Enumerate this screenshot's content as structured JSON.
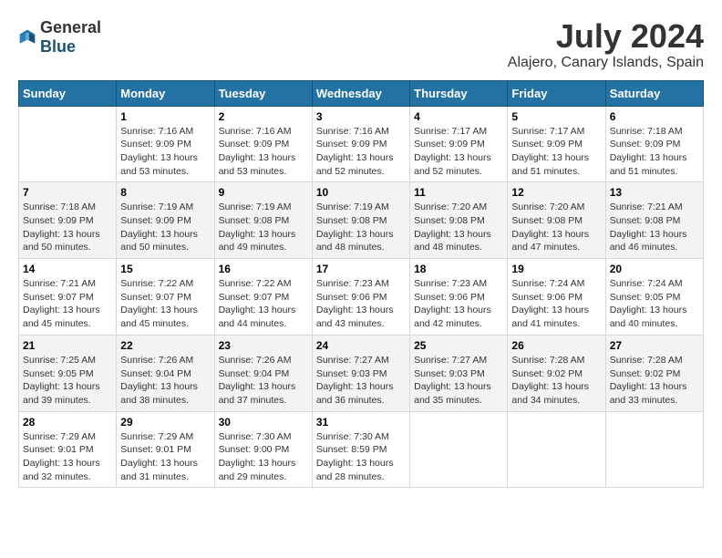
{
  "header": {
    "logo_general": "General",
    "logo_blue": "Blue",
    "month_year": "July 2024",
    "location": "Alajero, Canary Islands, Spain"
  },
  "days_of_week": [
    "Sunday",
    "Monday",
    "Tuesday",
    "Wednesday",
    "Thursday",
    "Friday",
    "Saturday"
  ],
  "weeks": [
    [
      {
        "day": "",
        "info": ""
      },
      {
        "day": "1",
        "info": "Sunrise: 7:16 AM\nSunset: 9:09 PM\nDaylight: 13 hours and 53 minutes."
      },
      {
        "day": "2",
        "info": "Sunrise: 7:16 AM\nSunset: 9:09 PM\nDaylight: 13 hours and 53 minutes."
      },
      {
        "day": "3",
        "info": "Sunrise: 7:16 AM\nSunset: 9:09 PM\nDaylight: 13 hours and 52 minutes."
      },
      {
        "day": "4",
        "info": "Sunrise: 7:17 AM\nSunset: 9:09 PM\nDaylight: 13 hours and 52 minutes."
      },
      {
        "day": "5",
        "info": "Sunrise: 7:17 AM\nSunset: 9:09 PM\nDaylight: 13 hours and 51 minutes."
      },
      {
        "day": "6",
        "info": "Sunrise: 7:18 AM\nSunset: 9:09 PM\nDaylight: 13 hours and 51 minutes."
      }
    ],
    [
      {
        "day": "7",
        "info": "Sunrise: 7:18 AM\nSunset: 9:09 PM\nDaylight: 13 hours and 50 minutes."
      },
      {
        "day": "8",
        "info": "Sunrise: 7:19 AM\nSunset: 9:09 PM\nDaylight: 13 hours and 50 minutes."
      },
      {
        "day": "9",
        "info": "Sunrise: 7:19 AM\nSunset: 9:08 PM\nDaylight: 13 hours and 49 minutes."
      },
      {
        "day": "10",
        "info": "Sunrise: 7:19 AM\nSunset: 9:08 PM\nDaylight: 13 hours and 48 minutes."
      },
      {
        "day": "11",
        "info": "Sunrise: 7:20 AM\nSunset: 9:08 PM\nDaylight: 13 hours and 48 minutes."
      },
      {
        "day": "12",
        "info": "Sunrise: 7:20 AM\nSunset: 9:08 PM\nDaylight: 13 hours and 47 minutes."
      },
      {
        "day": "13",
        "info": "Sunrise: 7:21 AM\nSunset: 9:08 PM\nDaylight: 13 hours and 46 minutes."
      }
    ],
    [
      {
        "day": "14",
        "info": "Sunrise: 7:21 AM\nSunset: 9:07 PM\nDaylight: 13 hours and 45 minutes."
      },
      {
        "day": "15",
        "info": "Sunrise: 7:22 AM\nSunset: 9:07 PM\nDaylight: 13 hours and 45 minutes."
      },
      {
        "day": "16",
        "info": "Sunrise: 7:22 AM\nSunset: 9:07 PM\nDaylight: 13 hours and 44 minutes."
      },
      {
        "day": "17",
        "info": "Sunrise: 7:23 AM\nSunset: 9:06 PM\nDaylight: 13 hours and 43 minutes."
      },
      {
        "day": "18",
        "info": "Sunrise: 7:23 AM\nSunset: 9:06 PM\nDaylight: 13 hours and 42 minutes."
      },
      {
        "day": "19",
        "info": "Sunrise: 7:24 AM\nSunset: 9:06 PM\nDaylight: 13 hours and 41 minutes."
      },
      {
        "day": "20",
        "info": "Sunrise: 7:24 AM\nSunset: 9:05 PM\nDaylight: 13 hours and 40 minutes."
      }
    ],
    [
      {
        "day": "21",
        "info": "Sunrise: 7:25 AM\nSunset: 9:05 PM\nDaylight: 13 hours and 39 minutes."
      },
      {
        "day": "22",
        "info": "Sunrise: 7:26 AM\nSunset: 9:04 PM\nDaylight: 13 hours and 38 minutes."
      },
      {
        "day": "23",
        "info": "Sunrise: 7:26 AM\nSunset: 9:04 PM\nDaylight: 13 hours and 37 minutes."
      },
      {
        "day": "24",
        "info": "Sunrise: 7:27 AM\nSunset: 9:03 PM\nDaylight: 13 hours and 36 minutes."
      },
      {
        "day": "25",
        "info": "Sunrise: 7:27 AM\nSunset: 9:03 PM\nDaylight: 13 hours and 35 minutes."
      },
      {
        "day": "26",
        "info": "Sunrise: 7:28 AM\nSunset: 9:02 PM\nDaylight: 13 hours and 34 minutes."
      },
      {
        "day": "27",
        "info": "Sunrise: 7:28 AM\nSunset: 9:02 PM\nDaylight: 13 hours and 33 minutes."
      }
    ],
    [
      {
        "day": "28",
        "info": "Sunrise: 7:29 AM\nSunset: 9:01 PM\nDaylight: 13 hours and 32 minutes."
      },
      {
        "day": "29",
        "info": "Sunrise: 7:29 AM\nSunset: 9:01 PM\nDaylight: 13 hours and 31 minutes."
      },
      {
        "day": "30",
        "info": "Sunrise: 7:30 AM\nSunset: 9:00 PM\nDaylight: 13 hours and 29 minutes."
      },
      {
        "day": "31",
        "info": "Sunrise: 7:30 AM\nSunset: 8:59 PM\nDaylight: 13 hours and 28 minutes."
      },
      {
        "day": "",
        "info": ""
      },
      {
        "day": "",
        "info": ""
      },
      {
        "day": "",
        "info": ""
      }
    ]
  ]
}
